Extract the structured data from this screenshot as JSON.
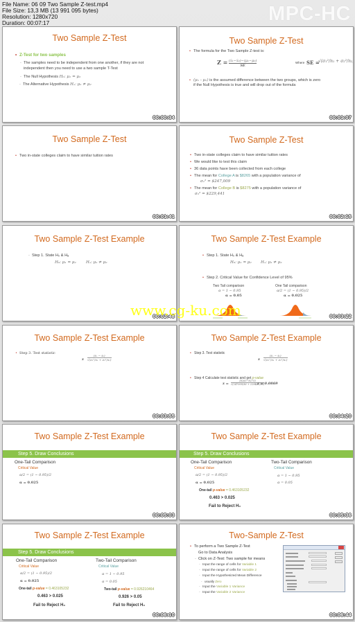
{
  "header": {
    "file_name": "File Name: 06 09 Two Sample Z-test.mp4",
    "file_size": "File Size: 13,3 MB (13 991 095 bytes)",
    "resolution": "Resolution: 1280x720",
    "duration": "Duration: 00:07:17",
    "brand": "MPC-HC"
  },
  "watermark": "www.cg-ku.com",
  "thumbnails": [
    {
      "title": "Two Sample Z-Test",
      "timestamp": "00:00:34",
      "heading": "Z-Test for two samples",
      "lines": [
        "The samples need to be independent from one another, if they are not",
        "independent then you need to use a two sample T-Test",
        "The Null Hypothesis",
        "The Alternative Hypothesis"
      ],
      "null_hyp": "H₀: μ₁ = μ₂",
      "alt_hyp": "Hₐ: μ₁ ≠ μ₂"
    },
    {
      "title": "Two Sample Z-Test",
      "timestamp": "00:01:07",
      "line1": "The formula for the Two Sample Z-test is:",
      "formula_lhs": "Z =",
      "formula_num": "(x̄₁−x̄₂)−(μ₁−μ₂)",
      "formula_den": "SE",
      "where": "Where",
      "se_lhs": "SE =",
      "se_rhs": "√(σ₁²/n₁ + σ₂²/n₂)",
      "line2_math": "(μ₁ - μ₂)",
      "line2": "is the assumed difference between the two groups, which is zero",
      "line3": "if the Null Hypothesis is true and  will drop out of the formula"
    },
    {
      "title": "Two Sample Z-Test",
      "timestamp": "00:01:41",
      "line1": "Two in-state colleges claim to have similar tuition rates"
    },
    {
      "title": "Two Sample Z-Test",
      "timestamp": "00:02:15",
      "lines": [
        "Two in-state colleges claim to have similar tuition rates",
        "We would like to test this claim",
        "36 data points have been collected from each college"
      ],
      "college_a": {
        "pre": "The mean for",
        "name": "College A",
        "mid": "is",
        "mean": "$8265",
        "post": "with a population variance of",
        "var": "σ₁² = $247,009"
      },
      "college_b": {
        "pre": "The mean for",
        "name": "College B",
        "mid": "is",
        "mean": "$8275",
        "post": "with a population variance of",
        "var": "σ₂² = $229,441"
      }
    },
    {
      "title": "Two Sample Z-Test Example",
      "timestamp": "00:02:48",
      "step1": "Step 1. State H₀ & Hₐ",
      "h0": "H₀: μ₁ = μ₂",
      "ha": "Hₐ: μ₁ ≠ μ₂"
    },
    {
      "title": "Two Sample Z-Test Example",
      "timestamp": "00:03:22",
      "step1": "Step 1. State H₀ & Hₐ",
      "h0": "H₀: μ₁ = μ₂",
      "ha": "Hₐ: μ₁ ≠ μ₂",
      "step2": "Step 2. Critical Value for Confidence Level of 95%",
      "two_tail": {
        "label": "Two Tail comparison",
        "eq1": "α = 1 − 0.95",
        "eq2": "α = 0.05"
      },
      "one_tail": {
        "label": "One Tail comparison",
        "eq1": "α/2 = (1 − 0.95)/2",
        "eq2": "α = 0.025"
      }
    },
    {
      "title": "Two Sample Z-Test Example",
      "timestamp": "00:03:55",
      "step3": "Step 3. Test statistic",
      "z": "z",
      "num": "(x̄₁ − x̄₂)",
      "den": "√(σ₁²/n₁ + σ₂²/n₂)"
    },
    {
      "title": "Two Sample Z-Test Example",
      "timestamp": "00:04:20",
      "step3": "Step 3. Test statistic",
      "z": "z",
      "num": "(x̄₁ − x̄₂)",
      "den": "√(σ₁²/n₁ + σ₂²/n₂)",
      "step4_pre": "Step 4 Calculate test statistic and get",
      "step4_pv": "p-value",
      "calc_lhs": "z =",
      "calc_num": "(8265−8275)",
      "calc_den": "√(247009/36 + 229441/36)",
      "calc_result": "z = 0.0869"
    },
    {
      "title": "Two Sample Z-Test Example",
      "timestamp": "00:05:03",
      "bar": "Step 5. Draw Conclusions",
      "one_tail": {
        "heading": "One-Tail Comparison",
        "critical": "Critical Value",
        "eq1": "α/2 = (1 − 0.95)/2",
        "eq2": "α = 0.025"
      }
    },
    {
      "title": "Two Sample Z-Test Example",
      "timestamp": "00:05:36",
      "bar": "Step 5. Draw Conclusions",
      "one_tail": {
        "heading": "One-Tail Comparison",
        "critical": "Critical Value",
        "eq1": "α/2 = (1 − 0.95)/2",
        "eq2": "α = 0.025",
        "pv_pre": "One-tail",
        "pv_label": "p-value",
        "pv_val": "= 0.463105232",
        "compare": "0.463 > 0.025",
        "conclusion": "Fail to Reject H₀"
      },
      "two_tail": {
        "heading": "Two-Tail Comparison",
        "critical": "Critical Value",
        "eq1": "α = 1 − 0.95",
        "eq2": "α = 0.05"
      }
    },
    {
      "title": "Two Sample Z-Test Example",
      "timestamp": "00:06:10",
      "bar": "Step 5. Draw Conclusions",
      "one_tail": {
        "heading": "One-Tail Comparison",
        "critical": "Critical Value",
        "eq1": "α/2 = (1 − 0.95)/2",
        "eq2": "α = 0.025",
        "pv_pre": "One-tail",
        "pv_label": "p-value",
        "pv_val": "= 0.463105232",
        "compare": "0.463 > 0.025",
        "conclusion": "Fail to Reject H₀"
      },
      "two_tail": {
        "heading": "Two-Tail Comparison",
        "critical": "Critical Value",
        "eq1": "α = 1 − 0.95",
        "eq2": "α = 0.05",
        "pv_pre": "Two-tail",
        "pv_label": "p-value",
        "pv_val": "= 0.926210464",
        "compare": "0.926 > 0.05",
        "conclusion": "Fail to Reject H₀"
      }
    },
    {
      "title": "Two-Sample Z-Test",
      "timestamp": "00:06:44",
      "line1": "To perform a Two Sample Z-Test",
      "line2": "Go to Data Analysis",
      "line3": "Click on Z-Test: Two sample for means",
      "sub": [
        {
          "pre": "Input the range of cells for",
          "hl": "Variable 1"
        },
        {
          "pre": "Input the range of cells for",
          "hl": "Variable 2"
        },
        {
          "pre": "Input the Hypothesized Mean Difference",
          "hl": ""
        },
        {
          "pre": "usually",
          "hl": "Zero"
        },
        {
          "pre": "Input the",
          "hl": "Variable 1 Variance"
        },
        {
          "pre": "Input the",
          "hl": "Variable 2 Variance"
        }
      ]
    }
  ]
}
